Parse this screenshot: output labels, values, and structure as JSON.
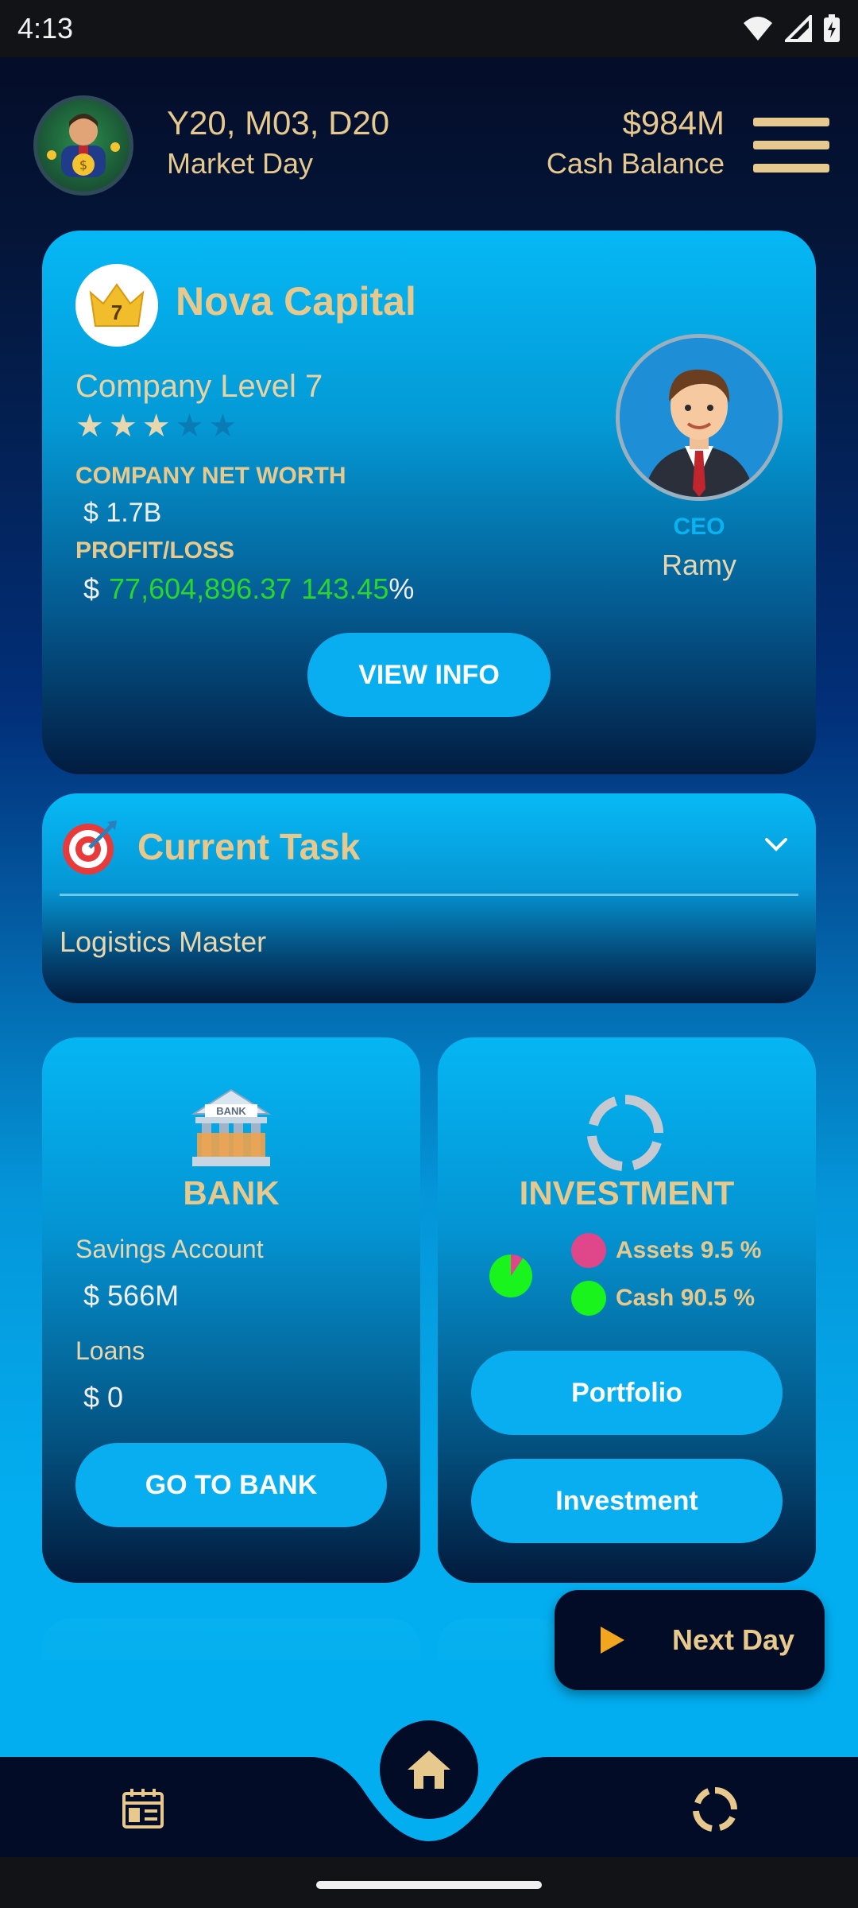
{
  "status_bar": {
    "time": "4:13"
  },
  "header": {
    "date": "Y20, M03, D20",
    "date_label": "Market Day",
    "cash_value": "$984M",
    "cash_label": "Cash Balance"
  },
  "company": {
    "level_badge": "7",
    "name": "Nova Capital",
    "level_text": "Company Level  7",
    "stars_filled": 3,
    "stars_total": 5,
    "net_worth_label": "COMPANY NET WORTH",
    "net_worth_value": "$ 1.7B",
    "pl_label": "PROFIT/LOSS",
    "pl_currency": "$",
    "pl_amount": "77,604,896.37",
    "pl_percent": "143.45",
    "pl_percent_sign": "%",
    "ceo_role": "CEO",
    "ceo_name": "Ramy",
    "view_info": "VIEW INFO"
  },
  "task": {
    "title": "Current Task",
    "name": "Logistics Master"
  },
  "bank": {
    "title": "BANK",
    "savings_label": "Savings Account",
    "savings_value": "$ 566M",
    "loans_label": "Loans",
    "loans_value": "$ 0",
    "button": "GO TO BANK"
  },
  "investment": {
    "title": "INVESTMENT",
    "assets_label": "Assets 9.5 %",
    "cash_label": "Cash 90.5 %",
    "assets_fraction": 0.095,
    "cash_fraction": 0.905,
    "assets_color": "#e0478a",
    "cash_color": "#19f51c",
    "portfolio_button": "Portfolio",
    "investment_button": "Investment"
  },
  "next_day": {
    "label": "Next Day"
  },
  "nav": {
    "left_icon": "calendar-icon",
    "center_icon": "home-icon",
    "right_icon": "investment-ring-icon"
  },
  "colors": {
    "gold": "#e8c98d",
    "accent": "#08aef0",
    "dark": "#030c26",
    "profit_green": "#29d62c"
  }
}
